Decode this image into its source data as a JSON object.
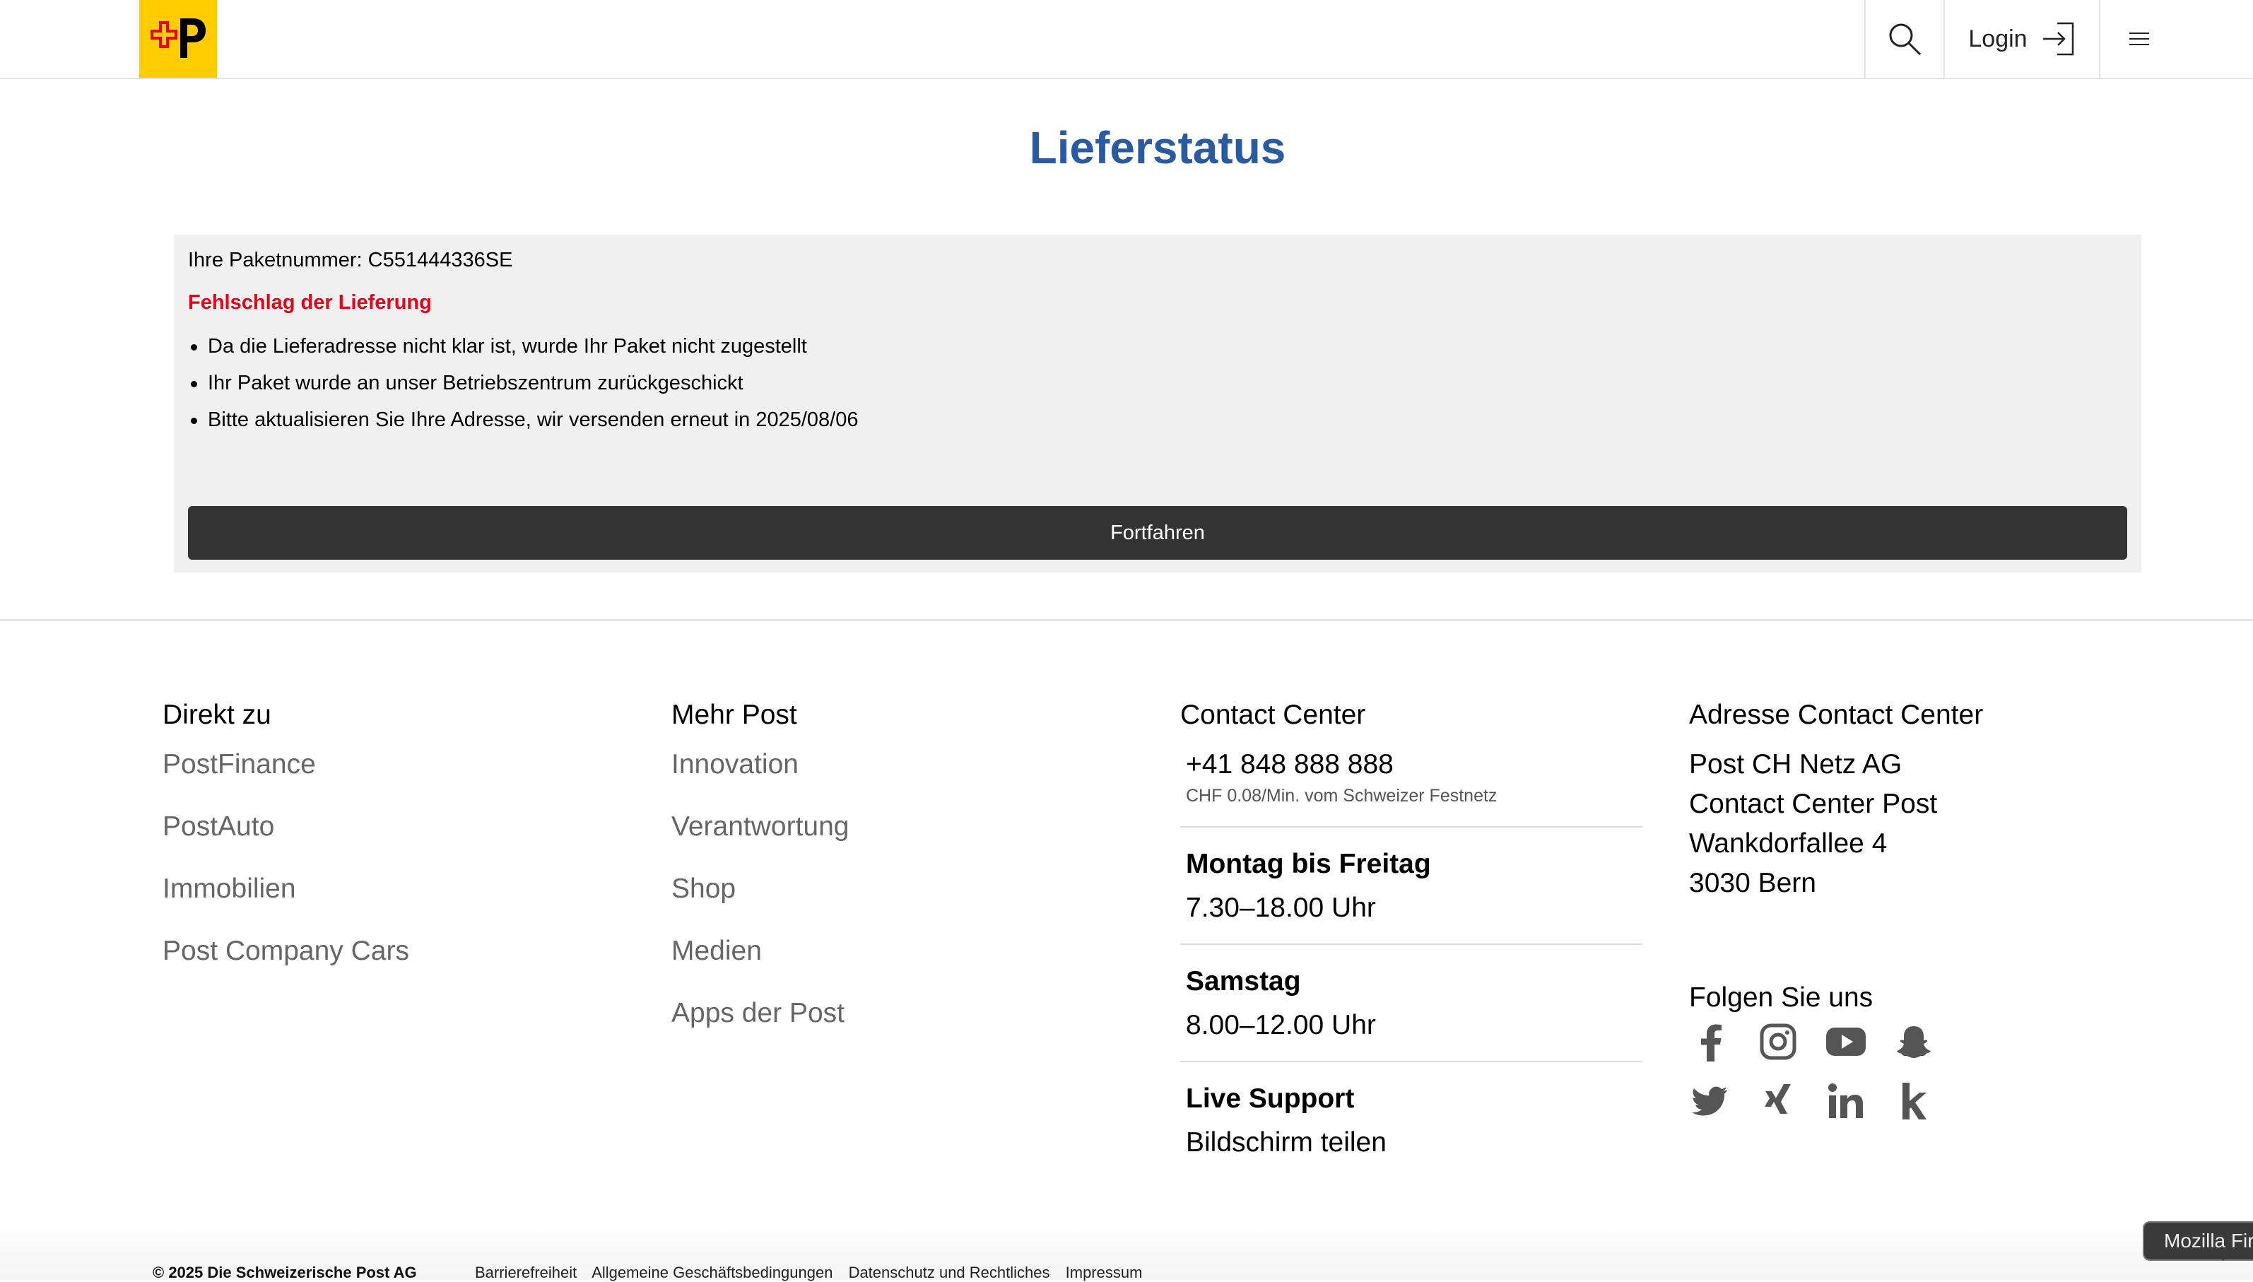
{
  "header": {
    "login_label": "Login"
  },
  "page": {
    "title": "Lieferstatus"
  },
  "status": {
    "package_line": "Ihre Paketnummer: C551444336SE",
    "failure_heading": "Fehlschlag der Lieferung",
    "bullets": [
      "Da die Lieferadresse nicht klar ist, wurde Ihr Paket nicht zugestellt",
      "Ihr Paket wurde an unser Betriebszentrum zurückgeschickt",
      "Bitte aktualisieren Sie Ihre Adresse, wir versenden erneut in 2025/08/06"
    ],
    "continue_label": "Fortfahren"
  },
  "footer": {
    "direkt": {
      "heading": "Direkt zu",
      "links": [
        "PostFinance",
        "PostAuto",
        "Immobilien",
        "Post Company Cars"
      ]
    },
    "mehr": {
      "heading": "Mehr Post",
      "links": [
        "Innovation",
        "Verantwortung",
        "Shop",
        "Medien",
        "Apps der Post"
      ]
    },
    "contact": {
      "heading": "Contact Center",
      "phone": "+41 848 888 888",
      "phone_note": "CHF 0.08/Min. vom Schweizer Festnetz",
      "weekday_heading": "Montag bis Freitag",
      "weekday_hours": "7.30–18.00 Uhr",
      "saturday_heading": "Samstag",
      "saturday_hours": "8.00–12.00 Uhr",
      "live_heading": "Live Support",
      "live_text": "Bildschirm teilen"
    },
    "address": {
      "heading": "Adresse Contact Center",
      "lines": [
        "Post CH Netz AG",
        "Contact Center Post",
        "Wankdorfallee 4",
        "3030 Bern"
      ]
    },
    "follow_heading": "Folgen Sie uns",
    "social_icons": [
      "facebook-icon",
      "instagram-icon",
      "youtube-icon",
      "snapchat-icon",
      "twitter-icon",
      "xing-icon",
      "linkedin-icon",
      "kununu-icon"
    ]
  },
  "bottom_bar": {
    "copyright": "© 2025 Die Schweizerische Post AG",
    "links": [
      "Barrierefreiheit",
      "Allgemeine Geschäftsbedingungen",
      "Datenschutz und Rechtliches",
      "Impressum"
    ]
  },
  "tooltip": "Mozilla Fir",
  "colors": {
    "brand_yellow": "#ffcc00",
    "title_blue": "#2a5aa0",
    "error_red": "#e2001a",
    "button_dark": "#333333"
  }
}
